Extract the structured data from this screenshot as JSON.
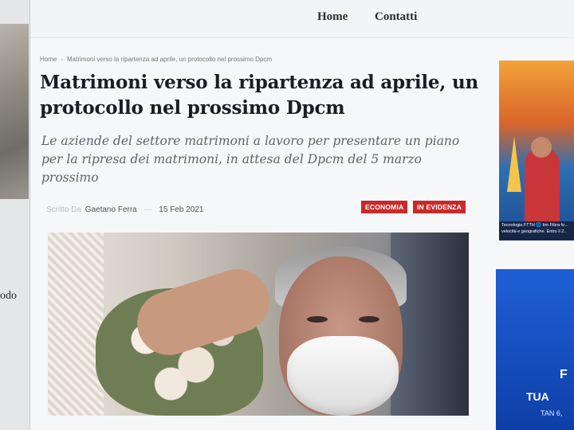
{
  "left_window": {
    "fragment_text": "odo"
  },
  "nav": {
    "home_label": "Home",
    "contatti_label": "Contatti"
  },
  "breadcrumb": {
    "home": "Home",
    "separator": "›",
    "current": "Matrimoni verso la ripartenza ad aprile, un protocollo nel prossimo Dpcm"
  },
  "article": {
    "title": "Matrimoni verso la ripartenza ad aprile, un protocollo nel prossimo Dpcm",
    "subtitle": "Le aziende del settore matrimoni a lavoro per presentare un piano per la ripresa dei matrimoni, in attesa del Dpcm del 5 marzo prossimo",
    "byline_prefix": "Scritto Da",
    "author": "Gaetano Ferra",
    "date": "15 Feb 2021",
    "tags": [
      "ECONOMIA",
      "IN EVIDENZA"
    ]
  },
  "sidebar": {
    "ad1_caption": "Tecnologia FTTH 🌐 tim Fibra fo... velocità e geografiche. Entro il 2..",
    "ad2_line1": "F",
    "ad2_line2": "TUA",
    "ad2_line3": "TAN 6,"
  },
  "colors": {
    "tag_red": "#c72b2b",
    "title_text": "#1a1d22",
    "subtitle_text": "#5f636a"
  }
}
